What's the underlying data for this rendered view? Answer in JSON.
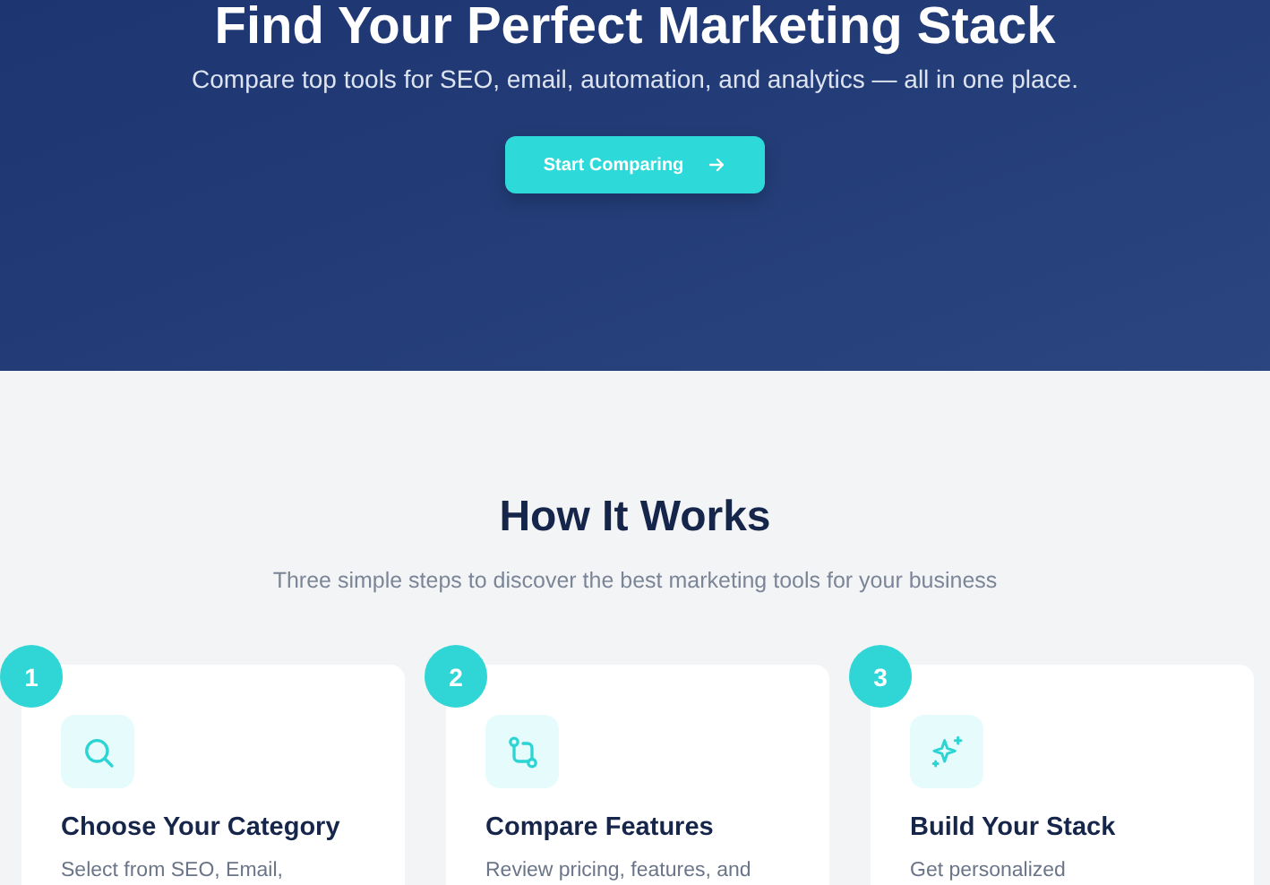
{
  "hero": {
    "title": "Find Your Perfect Marketing Stack",
    "subtitle": "Compare top tools for SEO, email, automation, and analytics — all in one place.",
    "button": {
      "label": "Start Comparing"
    }
  },
  "how_it_works": {
    "title": "How It Works",
    "subtitle": "Three simple steps to discover the best marketing tools for your business",
    "steps": [
      {
        "number": "1",
        "kind": "search",
        "title": "Choose Your Category",
        "description": "Select from SEO, Email,"
      },
      {
        "number": "2",
        "kind": "compare",
        "title": "Compare Features",
        "description": "Review pricing, features, and"
      },
      {
        "number": "3",
        "kind": "sparkle",
        "title": "Build Your Stack",
        "description": "Get personalized"
      }
    ]
  }
}
